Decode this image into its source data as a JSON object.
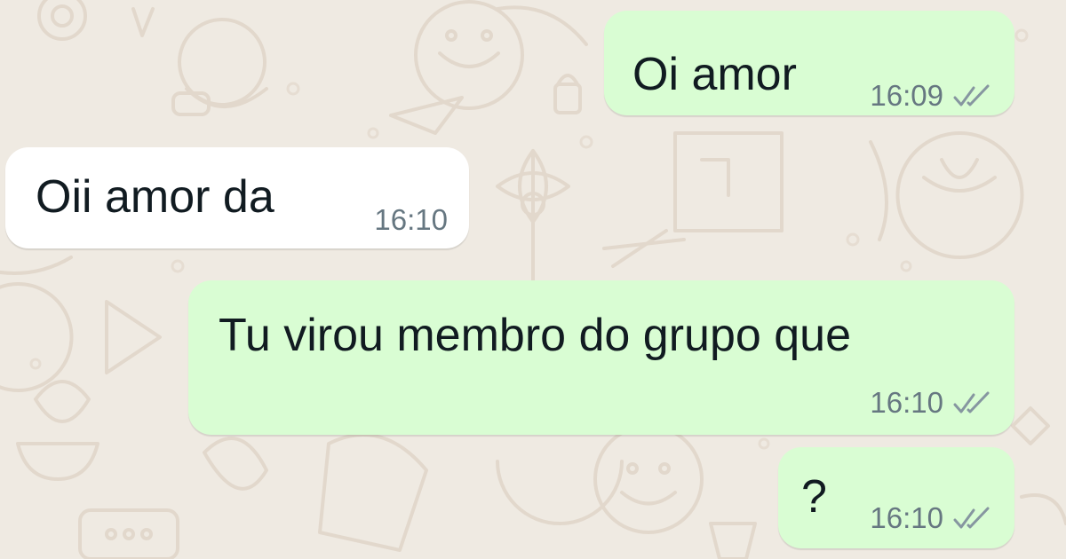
{
  "colors": {
    "wallpaper": "#efeae2",
    "outgoing_bubble": "#d9fdd3",
    "incoming_bubble": "#ffffff",
    "text": "#111b21",
    "meta_text": "#667781",
    "tick": "#8696a0"
  },
  "messages": [
    {
      "direction": "outgoing",
      "text": "Oi amor",
      "time": "16:09",
      "status_icon": "double-check-icon"
    },
    {
      "direction": "incoming",
      "text": "Oii amor da",
      "time": "16:10"
    },
    {
      "direction": "outgoing",
      "text": "Tu virou membro do grupo que",
      "time": "16:10",
      "status_icon": "double-check-icon"
    },
    {
      "direction": "outgoing",
      "text": "?",
      "time": "16:10",
      "status_icon": "double-check-icon"
    }
  ]
}
